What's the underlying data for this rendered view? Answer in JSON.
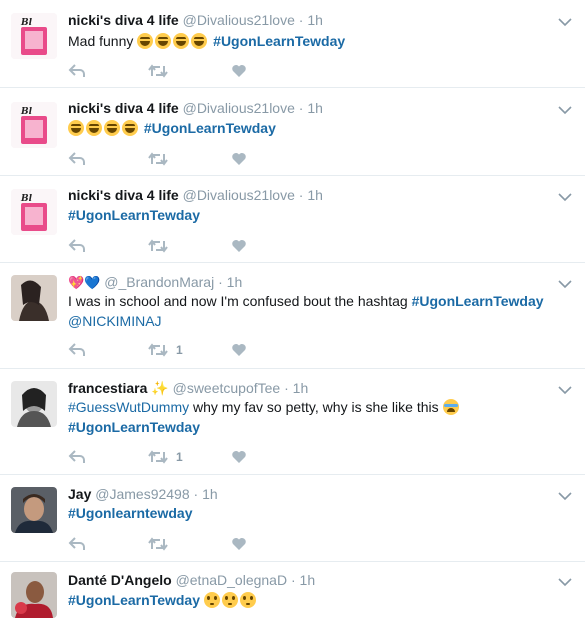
{
  "colors": {
    "hashtag": "#1b6aa5",
    "muted": "#8899a6",
    "icon": "#aab8c2",
    "divider": "#e6ecf0"
  },
  "tweets": [
    {
      "name": "nicki's diva 4 life",
      "handle": "@Divalious21love",
      "time": "1h",
      "text_prefix": "Mad funny",
      "emojis": "😂😂😂😂",
      "hashtag": "#UgonLearnTewday",
      "retweets": "",
      "avatar": "diva-avatar"
    },
    {
      "name": "nicki's diva 4 life",
      "handle": "@Divalious21love",
      "time": "1h",
      "emojis": "😂😂😂😂",
      "hashtag": "#UgonLearnTewday",
      "retweets": "",
      "avatar": "diva-avatar"
    },
    {
      "name": "nicki's diva 4 life",
      "handle": "@Divalious21love",
      "time": "1h",
      "hashtag": "#UgonLearnTewday",
      "retweets": "",
      "avatar": "diva-avatar"
    },
    {
      "name_emojis": "💖💙",
      "handle": "@_BrandonMaraj",
      "time": "1h",
      "text": "I was in school and now I'm confused bout the hashtag",
      "hashtag": "#UgonLearnTewday",
      "mention": "@NICKIMINAJ",
      "retweets": "1",
      "avatar": "brandon-avatar"
    },
    {
      "name": "francestiara",
      "name_emoji": "✨",
      "handle": "@sweetcupofTee",
      "time": "1h",
      "hashtag_lead": "#GuessWutDummy",
      "text": "why my fav so petty, why is she like this",
      "emoji": "😭",
      "hashtag": "#UgonLearnTewday",
      "retweets": "1",
      "avatar": "frances-avatar"
    },
    {
      "name": "Jay",
      "handle": "@James92498",
      "time": "1h",
      "hashtag": "#Ugonlearntewday",
      "retweets": "",
      "avatar": "jay-avatar"
    },
    {
      "name": "Danté D'Angelo",
      "handle": "@etnaD_olegnaD",
      "time": "1h",
      "hashtag": "#UgonLearnTewday",
      "emojis": "😳😳😳",
      "avatar": "dante-avatar"
    }
  ],
  "separator": "·"
}
